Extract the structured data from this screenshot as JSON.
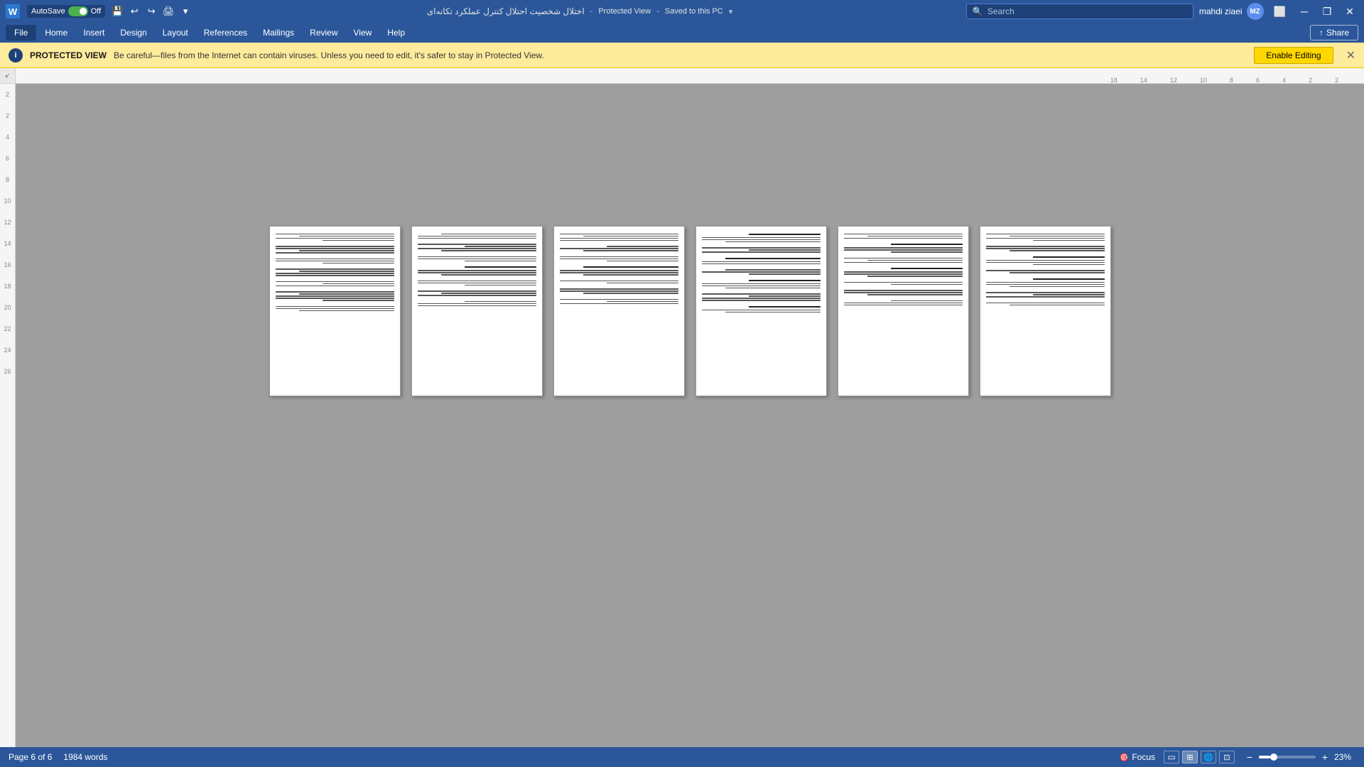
{
  "titlebar": {
    "autosave_label": "AutoSave",
    "autosave_state": "Off",
    "document_title": "اختلال شخصیت احتلال کنترل عملکرد تکانه‌ای",
    "protected_view_label": "Protected View",
    "saved_label": "Saved to this PC",
    "search_placeholder": "Search",
    "user_name": "mahdi ziaei",
    "user_initials": "MZ",
    "window_controls": {
      "minimize": "─",
      "restore": "❐",
      "close": "✕"
    }
  },
  "menu": {
    "items": [
      "File",
      "Home",
      "Insert",
      "Design",
      "Layout",
      "References",
      "Mailings",
      "Review",
      "View",
      "Help"
    ],
    "share_label": "Share"
  },
  "protected_bar": {
    "label": "PROTECTED VIEW",
    "message": "Be careful—files from the Internet can contain viruses. Unless you need to edit, it's safer to stay in Protected View.",
    "enable_editing_label": "Enable Editing",
    "shield_symbol": "i"
  },
  "ruler": {
    "numbers": [
      "18",
      "14",
      "12",
      "10",
      "8",
      "6",
      "4",
      "2",
      "2"
    ]
  },
  "vertical_ruler": {
    "numbers": [
      "2",
      "2",
      "4",
      "6",
      "8",
      "10",
      "12",
      "14",
      "16",
      "18",
      "20",
      "22",
      "24",
      "26"
    ]
  },
  "status_bar": {
    "page_info": "Page 6 of 6",
    "word_count": "1984 words",
    "focus_label": "Focus",
    "zoom_percent": "23%"
  },
  "pages": [
    {
      "id": 1,
      "lines": [
        12,
        8,
        5,
        10,
        7,
        9,
        6,
        11,
        8,
        7,
        10,
        6,
        9,
        5,
        8
      ]
    },
    {
      "id": 2,
      "lines": [
        10,
        7,
        8,
        6,
        11,
        9,
        5,
        8,
        7,
        10,
        6,
        9,
        8,
        5,
        7
      ]
    },
    {
      "id": 3,
      "lines": [
        8,
        9,
        7,
        10,
        6,
        8,
        11,
        5,
        9,
        7,
        8,
        10,
        6,
        7,
        9
      ]
    },
    {
      "id": 4,
      "lines": [
        11,
        7,
        9,
        6,
        8,
        10,
        7,
        9,
        5,
        8,
        11,
        6,
        7,
        9,
        8
      ]
    },
    {
      "id": 5,
      "lines": [
        9,
        8,
        7,
        10,
        6,
        9,
        8,
        7,
        11,
        5,
        8,
        9,
        7,
        6,
        10
      ]
    },
    {
      "id": 6,
      "lines": [
        7,
        10,
        8,
        6,
        9,
        7,
        11,
        8,
        5,
        9,
        7,
        8,
        10,
        6,
        7
      ]
    }
  ]
}
